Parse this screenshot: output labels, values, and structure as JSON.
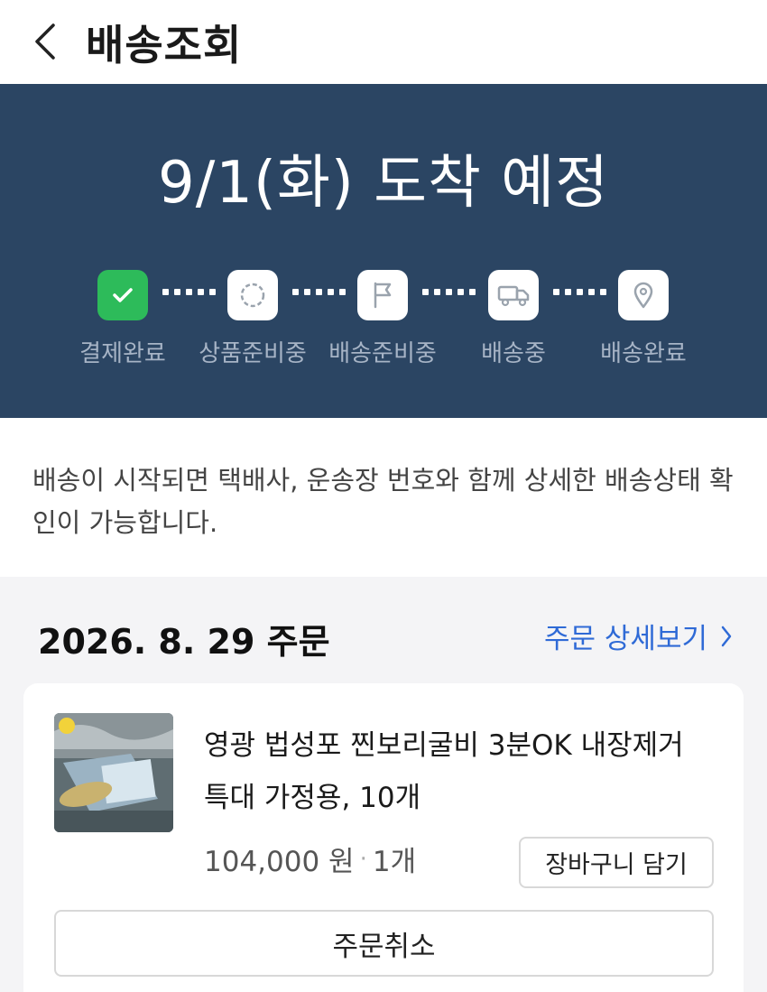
{
  "header": {
    "title": "배송조회",
    "back_icon": "chevron-left-icon"
  },
  "delivery": {
    "eta": "9/1(화) 도착 예정",
    "steps": [
      {
        "label": "결제완료",
        "icon": "check-icon",
        "status": "done"
      },
      {
        "label": "상품준비중",
        "icon": "loading-circle-icon",
        "status": "pending"
      },
      {
        "label": "배송준비중",
        "icon": "flag-icon",
        "status": "pending"
      },
      {
        "label": "배송중",
        "icon": "truck-icon",
        "status": "pending"
      },
      {
        "label": "배송완료",
        "icon": "location-pin-icon",
        "status": "pending"
      }
    ],
    "colors": {
      "hero_bg": "#2b4563",
      "done": "#2dbb5a",
      "label": "#a7b4c6"
    }
  },
  "notice": {
    "text": "배송이 시작되면 택배사, 운송장 번호와 함께 상세한 배송상태 확인이 가능합니다."
  },
  "order": {
    "date_label": "2026. 8. 29 주문",
    "detail_link": "주문 상세보기",
    "link_color": "#2f6ad6",
    "item": {
      "name": "영광 법성포 찐보리굴비 3분OK 내장제거 특대 가정용, 10개",
      "price": "104,000 원",
      "separator": "·",
      "quantity": "1개",
      "cart_button": "장바구니 담기"
    },
    "cancel_button": "주문취소"
  }
}
